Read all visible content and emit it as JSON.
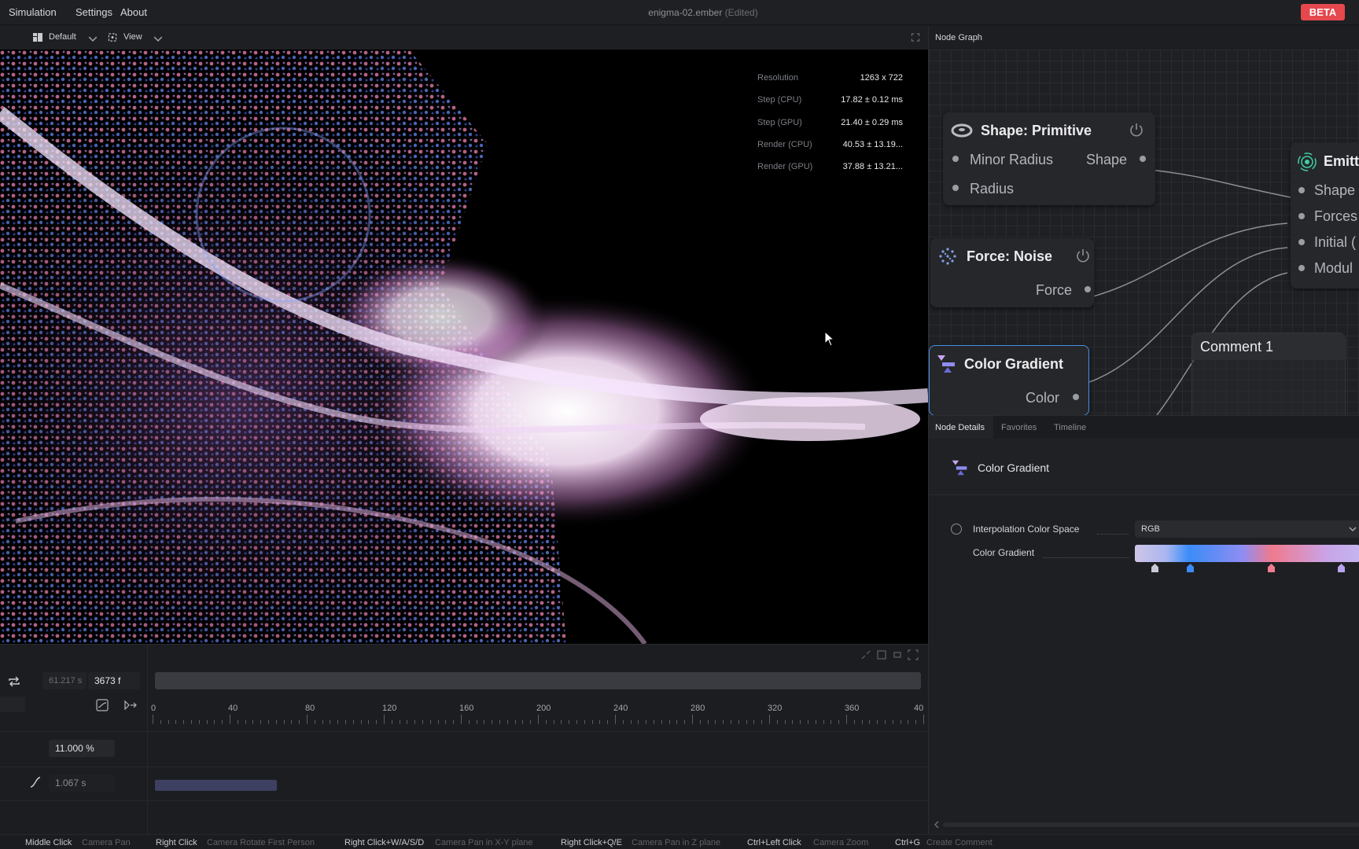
{
  "menubar": {
    "items": [
      "Simulation",
      "Settings",
      "About"
    ],
    "file_title": "enigma-02.ember",
    "edited_label": "(Edited)",
    "badge": "BETA"
  },
  "viewport_toolbar": {
    "preset_label": "Default",
    "view_label": "View"
  },
  "stats": [
    {
      "label": "Resolution",
      "value": "1263 x 722"
    },
    {
      "label": "Step (CPU)",
      "value": "17.82 ± 0.12 ms"
    },
    {
      "label": "Step (GPU)",
      "value": "21.40 ± 0.29 ms"
    },
    {
      "label": "Render (CPU)",
      "value": "40.53 ± 13.19..."
    },
    {
      "label": "Render (GPU)",
      "value": "37.88 ± 13.21..."
    }
  ],
  "timeline": {
    "time_seconds": "61.217 s",
    "frame": "3673 f",
    "ruler_labels": [
      "0",
      "40",
      "80",
      "120",
      "160",
      "200",
      "240",
      "280",
      "320",
      "360",
      "40"
    ],
    "percent_field": "11.000 %",
    "duration_field": "1.067 s"
  },
  "node_graph": {
    "header": "Node Graph",
    "nodes": {
      "shape_primitive": {
        "title": "Shape: Primitive",
        "inputs": [
          "Minor Radius",
          "Radius"
        ],
        "output": "Shape"
      },
      "force_noise": {
        "title": "Force: Noise",
        "output": "Force"
      },
      "color_gradient": {
        "title": "Color Gradient",
        "output": "Color"
      },
      "emitter": {
        "title": "Emitt",
        "inputs": [
          "Shape",
          "Forces",
          "Initial (",
          "Modul"
        ]
      },
      "comment": {
        "title": "Comment 1"
      }
    }
  },
  "tabs": [
    "Node Details",
    "Favorites",
    "Timeline"
  ],
  "details": {
    "node_name": "Color Gradient",
    "properties": {
      "interp_label": "Interpolation Color Space",
      "interp_value": "RGB",
      "gradient_label": "Color Gradient"
    },
    "gradient_stop_colors": [
      "#c8c9d4",
      "#3b8cf7",
      "#f07a8e",
      "#b8a3f0"
    ]
  },
  "statusbar": [
    {
      "key": "Middle Click",
      "action": "Camera Pan"
    },
    {
      "key": "Right Click",
      "action": "Camera Rotate First Person"
    },
    {
      "key": "Right Click+W/A/S/D",
      "action": "Camera Pan in X-Y plane"
    },
    {
      "key": "Right Click+Q/E",
      "action": "Camera Pan in Z plane"
    },
    {
      "key": "Ctrl+Left Click",
      "action": "Camera Zoom"
    },
    {
      "key": "Ctrl+G",
      "action": "Create Comment"
    }
  ]
}
